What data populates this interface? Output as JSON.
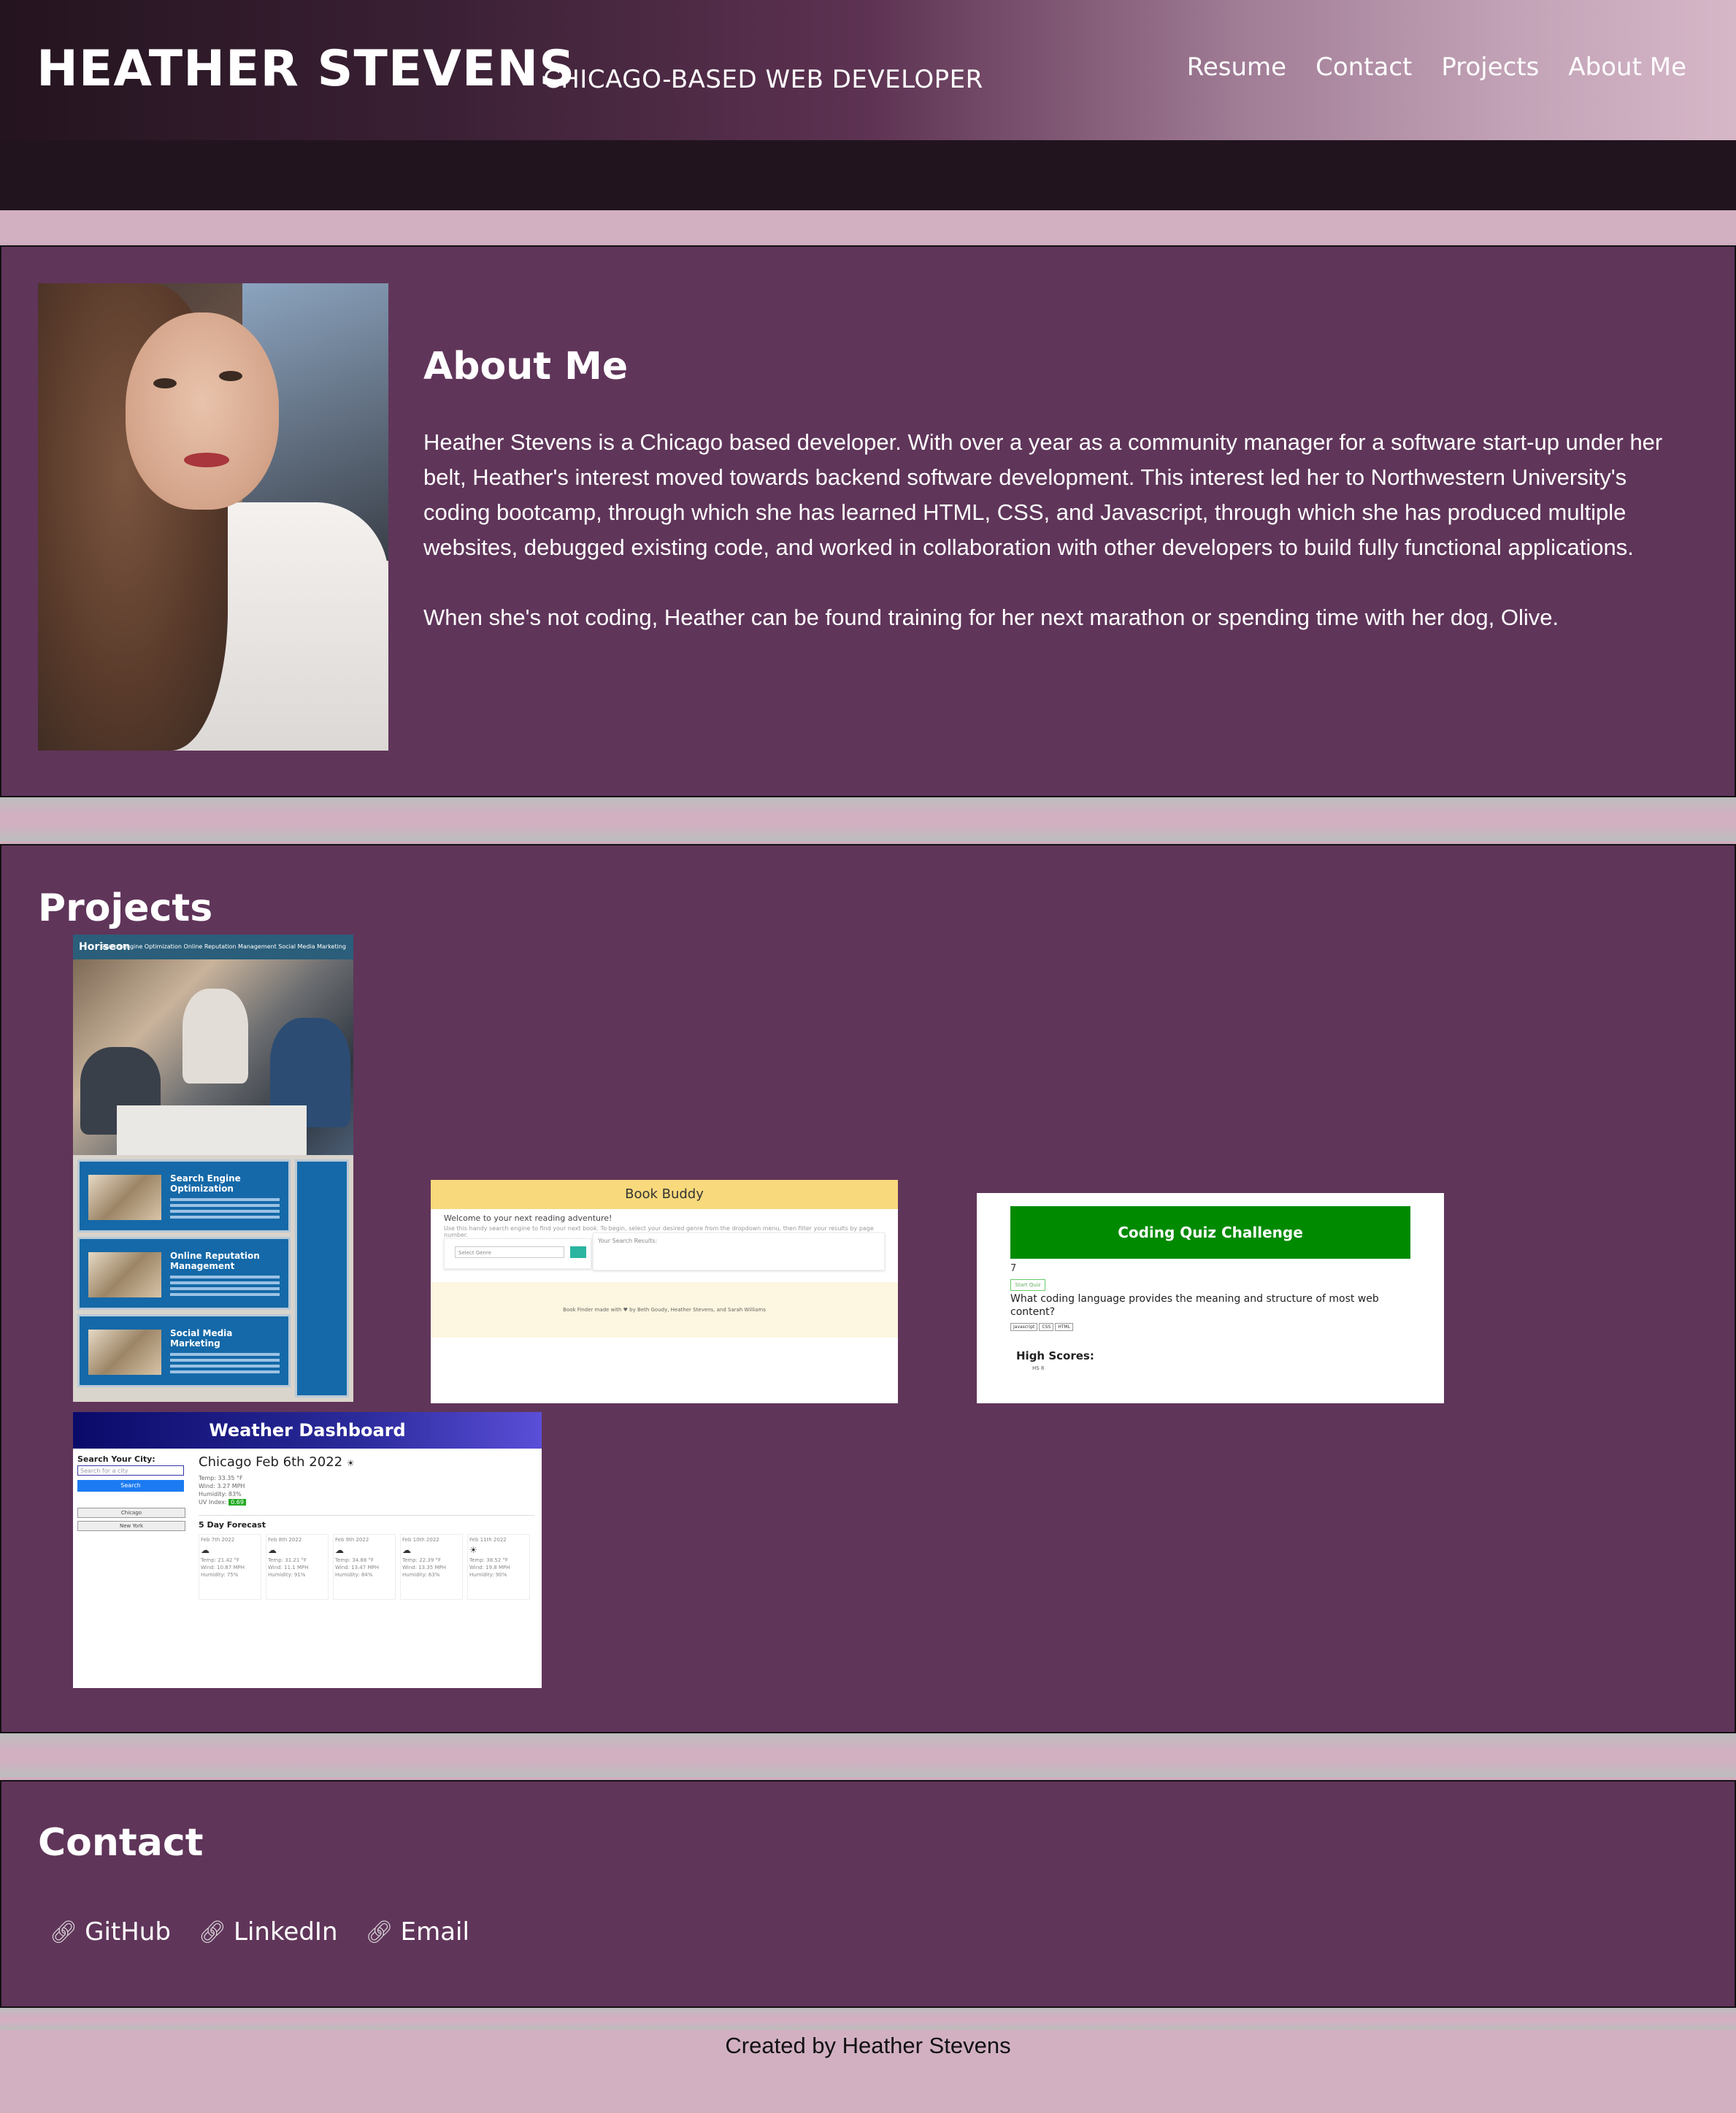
{
  "header": {
    "name": "HEATHER STEVENS",
    "tagline": "CHICAGO-BASED WEB DEVELOPER",
    "nav": [
      "Resume",
      "Contact",
      "Projects",
      "About Me"
    ]
  },
  "about": {
    "title": "About Me",
    "paragraphs": [
      "Heather Stevens is a Chicago based developer. With over a year as a community manager for a software start-up under her belt, Heather's interest moved towards backend software development. This interest led her to Northwestern University's coding bootcamp, through which she has learned HTML, CSS, and Javascript, through which she has produced multiple websites, debugged existing code, and worked in collaboration with other developers to build fully functional applications.",
      "When she's not coding, Heather can be found training for her next marathon or spending time with her dog, Olive."
    ]
  },
  "projects": {
    "title": "Projects",
    "horiseon": {
      "brand": "Horiseon",
      "nav": "Search Engine Optimization   Online Reputation Management   Social Media Marketing",
      "cards": [
        "Search Engine Optimization",
        "Online Reputation Management",
        "Social Media Marketing"
      ]
    },
    "bookbuddy": {
      "title": "Book Buddy",
      "welcome": "Welcome to your next reading adventure!",
      "sub": "Use this handy search engine to find your next book. To begin, select your desired genre from the dropdown menu, then filter your results by page number.",
      "select": "Select Genre",
      "results": "Your Search Results:",
      "footer": "Book Finder made with ♥ by Beth Goudy, Heather Stevens, and Sarah Williams"
    },
    "quiz": {
      "title": "Coding Quiz Challenge",
      "number": "7",
      "start": "Start Quiz",
      "question": "What coding language provides the meaning and structure of most web content?",
      "options": [
        "Javascript",
        "CSS",
        "HTML"
      ],
      "highscores": "High Scores:",
      "score": "HS 8"
    },
    "weather": {
      "title": "Weather Dashboard",
      "search_label": "Search Your City:",
      "search_placeholder": "Search for a city",
      "search_btn": "Search",
      "history": [
        "Chicago",
        "New York"
      ],
      "city": "Chicago Feb 6th 2022",
      "stats": [
        "Temp: 33.35 °F",
        "Wind: 3.27 MPH",
        "Humidity: 83%"
      ],
      "uv_label": "UV Index:",
      "uv": "0.69",
      "forecast_title": "5 Day Forecast",
      "days": [
        {
          "date": "Feb 7th 2022",
          "temp": "Temp: 21.42 °F",
          "wind": "Wind: 10.87 MPH",
          "hum": "Humidity: 75%"
        },
        {
          "date": "Feb 8th 2022",
          "temp": "Temp: 31.21 °F",
          "wind": "Wind: 11.1 MPH",
          "hum": "Humidity: 91%"
        },
        {
          "date": "Feb 9th 2022",
          "temp": "Temp: 34.88 °F",
          "wind": "Wind: 13.47 MPH",
          "hum": "Humidity: 84%"
        },
        {
          "date": "Feb 10th 2022",
          "temp": "Temp: 22.39 °F",
          "wind": "Wind: 13.35 MPH",
          "hum": "Humidity: 63%"
        },
        {
          "date": "Feb 11th 2022",
          "temp": "Temp: 38.52 °F",
          "wind": "Wind: 19.8 MPH",
          "hum": "Humidity: 90%"
        }
      ]
    }
  },
  "contact": {
    "title": "Contact",
    "links": [
      "GitHub",
      "LinkedIn",
      "Email"
    ]
  },
  "footer": {
    "text": "Created by Heather Stevens"
  },
  "icons": {
    "link": "link-icon"
  },
  "colors": {
    "panel": "#60355a",
    "page": "#d2b0c2",
    "header_dark": "#22141f",
    "quiz_green": "#008a00",
    "bookbuddy_yellow": "#f8d97c"
  }
}
